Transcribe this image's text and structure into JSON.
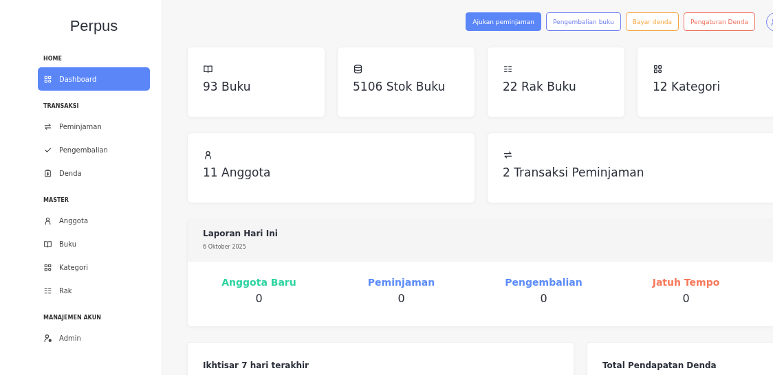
{
  "sidebar": {
    "brand": "Perpus",
    "sections": [
      {
        "title": "HOME",
        "items": [
          {
            "label": "Dashboard",
            "selected": true
          }
        ]
      },
      {
        "title": "TRANSAKSI",
        "items": [
          {
            "label": "Peminjaman",
            "selected": false
          },
          {
            "label": "Pengembalian",
            "selected": false
          },
          {
            "label": "Denda",
            "selected": false
          }
        ]
      },
      {
        "title": "MASTER",
        "items": [
          {
            "label": "Anggota",
            "selected": false
          },
          {
            "label": "Buku",
            "selected": false
          },
          {
            "label": "Kategori",
            "selected": false
          },
          {
            "label": "Rak",
            "selected": false
          }
        ]
      },
      {
        "title": "MANAJEMEN AKUN",
        "items": [
          {
            "label": "Admin",
            "selected": false
          }
        ]
      }
    ]
  },
  "toolbar": {
    "buttons": [
      {
        "label": "Ajukan peminjaman",
        "kind": "filled",
        "color": "#5b86f8"
      },
      {
        "label": "Pengembalian buku",
        "kind": "outline",
        "color": "#6f7ff0"
      },
      {
        "label": "Bayar denda",
        "kind": "outline",
        "color": "#f5a742"
      },
      {
        "label": "Pengaturan Denda",
        "kind": "outline",
        "color": "#f0705c"
      }
    ]
  },
  "stats": [
    {
      "label": "93 Buku"
    },
    {
      "label": "5106 Stok Buku"
    },
    {
      "label": "22 Rak Buku"
    },
    {
      "label": "12 Kategori"
    },
    {
      "label": "11 Anggota"
    },
    {
      "label": "2 Transaksi Peminjaman"
    }
  ],
  "report": {
    "title": "Laporan Hari Ini",
    "date": "6 Oktober 2025",
    "items": [
      {
        "label": "Anggota Baru",
        "value": "0",
        "color": "#2ed3a0"
      },
      {
        "label": "Peminjaman",
        "value": "0",
        "color": "#5b8cf8"
      },
      {
        "label": "Pengembalian",
        "value": "0",
        "color": "#5b8cf8"
      },
      {
        "label": "Jatuh Tempo",
        "value": "0",
        "color": "#f77a5c"
      }
    ]
  },
  "panels": [
    {
      "title": "Ikhtisar 7 hari terakhir"
    },
    {
      "title": "Total Pendapatan Denda"
    }
  ]
}
